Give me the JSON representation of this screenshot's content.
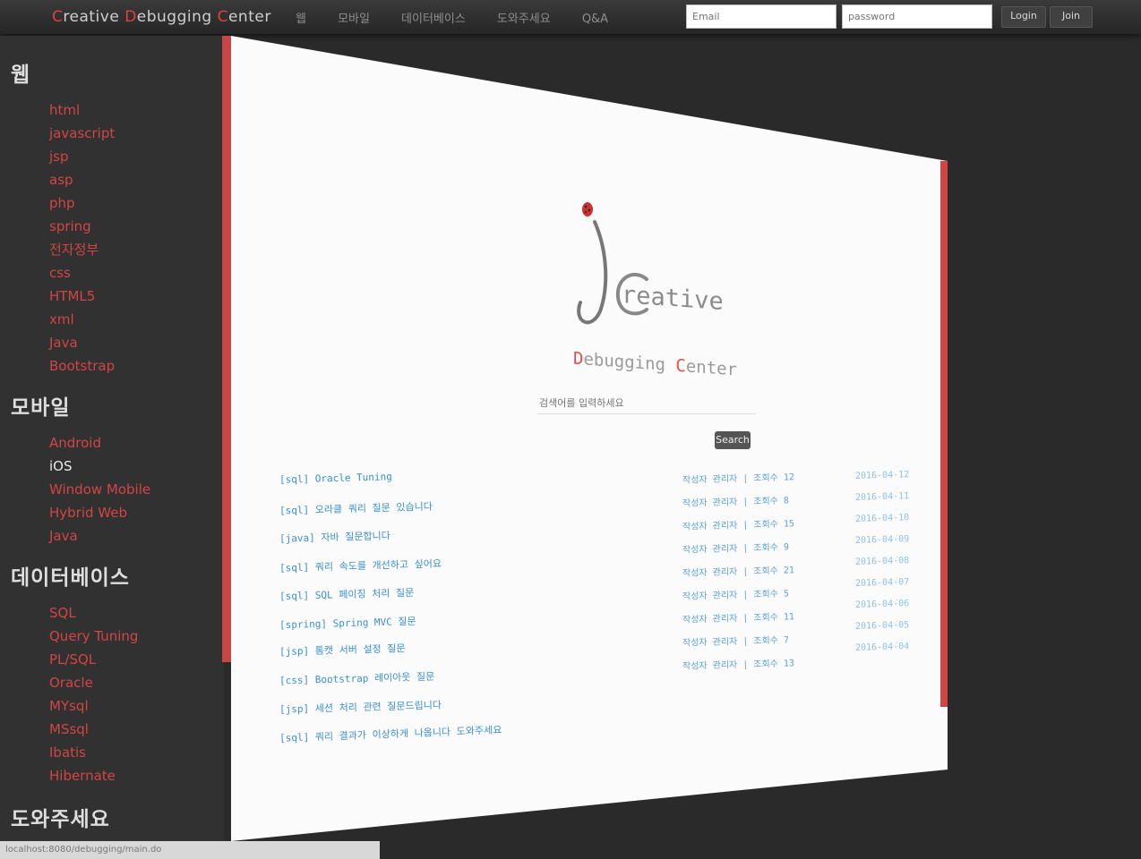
{
  "header": {
    "brand_c": "C",
    "brand_reative": "reative",
    "brand_d": "D",
    "brand_ebugging": "ebugging",
    "brand_c2": "C",
    "brand_enter": "enter",
    "nav": [
      "웹",
      "모바일",
      "데이터베이스",
      "도와주세요",
      "Q&A"
    ],
    "email_placeholder": "Email",
    "password_placeholder": "password",
    "login_label": "Login",
    "join_label": "Join"
  },
  "sidebar": {
    "sections": [
      {
        "title": "웹",
        "items": [
          "html",
          "javascript",
          "jsp",
          "asp",
          "php",
          "spring",
          "전자정부",
          "css",
          "HTML5",
          "xml",
          "Java",
          "Bootstrap"
        ]
      },
      {
        "title": "모바일",
        "items": [
          "Android",
          "iOS",
          "Window Mobile",
          "Hybrid Web",
          "Java"
        ]
      },
      {
        "title": "데이터베이스",
        "items": [
          "SQL",
          "Query Tuning",
          "PL/SQL",
          "Oracle",
          "MYsql",
          "MSsql",
          "Ibatis",
          "Hibernate"
        ]
      },
      {
        "title": "도와주세요",
        "items": []
      }
    ],
    "status_text": "localhost:8080/debugging/main.do"
  },
  "main": {
    "logo_word": "reative",
    "tagline_d": "D",
    "tagline_ebugging": "ebugging ",
    "tagline_c": "C",
    "tagline_enter": "enter",
    "search_placeholder": "검색어를 입력하세요",
    "search_button": "Search",
    "posts": [
      {
        "title": "[sql] Oracle Tuning",
        "meta": "작성자 관리자 | 조회수 12",
        "date": "2016-04-12"
      },
      {
        "title": "[sql] 오라클 쿼리 질문 있습니다",
        "meta": "작성자 관리자 | 조회수 8",
        "date": "2016-04-11"
      },
      {
        "title": "[java] 자바 질문합니다",
        "meta": "작성자 관리자 | 조회수 15",
        "date": "2016-04-10"
      },
      {
        "title": "[sql] 쿼리 속도를 개선하고 싶어요",
        "meta": "작성자 관리자 | 조회수 9",
        "date": "2016-04-09"
      },
      {
        "title": "[sql] SQL 페이징 처리 질문",
        "meta": "작성자 관리자 | 조회수 21",
        "date": "2016-04-08"
      },
      {
        "title": "[spring] Spring MVC 질문",
        "meta": "작성자 관리자 | 조회수 5",
        "date": "2016-04-07"
      },
      {
        "title": "[jsp] 톰캣 서버 설정 질문",
        "meta": "작성자 관리자 | 조회수 11",
        "date": "2016-04-06"
      },
      {
        "title": "[css] Bootstrap 레이아웃 질문",
        "meta": "작성자 관리자 | 조회수 7",
        "date": "2016-04-05"
      },
      {
        "title": "[jsp] 세션 처리 관련 질문드립니다",
        "meta": "작성자 관리자 | 조회수 13",
        "date": "2016-04-04"
      },
      {
        "title": "[sql] 쿼리 결과가 이상하게 나옵니다 도와주세요",
        "meta": "",
        "date": ""
      }
    ]
  },
  "colors": {
    "accent": "#d24545",
    "link": "#3a8fd0",
    "sidebar_bg": "#313131"
  }
}
